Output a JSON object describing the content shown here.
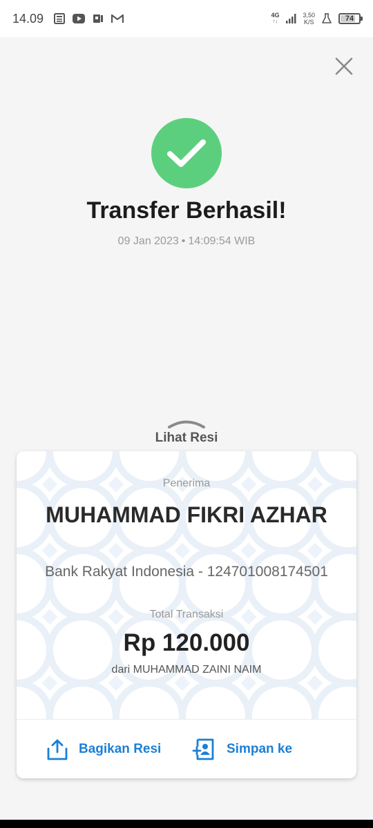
{
  "statusbar": {
    "time": "14.09",
    "network": "4G",
    "network_sub": "↑↓",
    "speed_value": "3,50",
    "speed_unit": "K/S",
    "battery": "74",
    "notification_icons": [
      "news-icon",
      "youtube-icon",
      "app-icon",
      "gmail-icon"
    ]
  },
  "header": {
    "close_icon": "close-icon"
  },
  "result": {
    "title": "Transfer Berhasil!",
    "date": "09 Jan 2023",
    "separator": "•",
    "time": "14:09:54 WIB",
    "status_icon": "check-circle-icon",
    "status_color": "#5ccf7e"
  },
  "receipt_toggle": {
    "label": "Lihat Resi",
    "icon": "chevron-up-icon"
  },
  "receipt": {
    "recipient_label": "Penerima",
    "recipient_name": "MUHAMMAD FIKRI AZHAR",
    "bank_account": "Bank Rakyat Indonesia - 124701008174501",
    "total_label": "Total Transaksi",
    "amount": "Rp 120.000",
    "sender": "dari MUHAMMAD ZAINI NAIM"
  },
  "actions": {
    "share_label": "Bagikan Resi",
    "save_label": "Simpan ke",
    "accent_color": "#1a7fd6"
  }
}
